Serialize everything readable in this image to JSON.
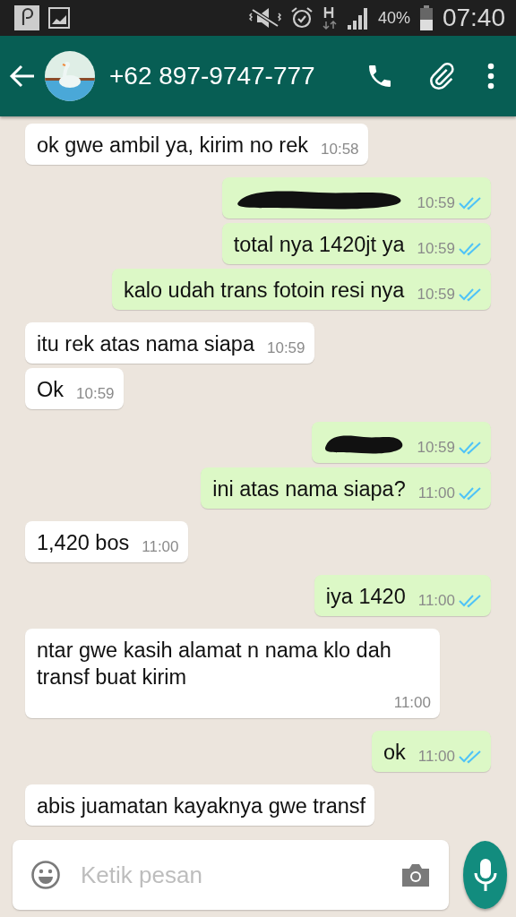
{
  "status_bar": {
    "battery": "40%",
    "time": "07:40"
  },
  "header": {
    "title": "+62 897-9747-777"
  },
  "messages": [
    {
      "kind": "text",
      "outgoing": false,
      "text": "ok gwe ambil ya, kirim no rek",
      "time": "10:58"
    },
    {
      "kind": "redacted",
      "outgoing": true,
      "time": "10:59",
      "read": true
    },
    {
      "kind": "text",
      "outgoing": true,
      "text": "total nya 1420jt ya",
      "time": "10:59",
      "read": true
    },
    {
      "kind": "text",
      "outgoing": true,
      "text": "kalo udah trans fotoin resi nya",
      "time": "10:59",
      "read": true
    },
    {
      "kind": "text",
      "outgoing": false,
      "text": "itu rek atas nama siapa",
      "time": "10:59"
    },
    {
      "kind": "text",
      "outgoing": false,
      "text": "Ok",
      "time": "10:59"
    },
    {
      "kind": "redacted",
      "outgoing": true,
      "time": "10:59",
      "read": true
    },
    {
      "kind": "text",
      "outgoing": true,
      "text": "ini atas nama siapa?",
      "time": "11:00",
      "read": true
    },
    {
      "kind": "text",
      "outgoing": false,
      "text": "1,420 bos",
      "time": "11:00"
    },
    {
      "kind": "text",
      "outgoing": true,
      "text": "iya 1420",
      "time": "11:00",
      "read": true
    },
    {
      "kind": "text",
      "outgoing": false,
      "text": "ntar gwe kasih alamat n nama klo dah transf buat kirim",
      "time": "11:00"
    },
    {
      "kind": "text",
      "outgoing": true,
      "text": "ok",
      "time": "11:00",
      "read": true
    },
    {
      "kind": "text",
      "outgoing": false,
      "text": "abis juamatan kayaknya gwe transf"
    }
  ],
  "composer": {
    "placeholder": "Ketik pesan"
  }
}
